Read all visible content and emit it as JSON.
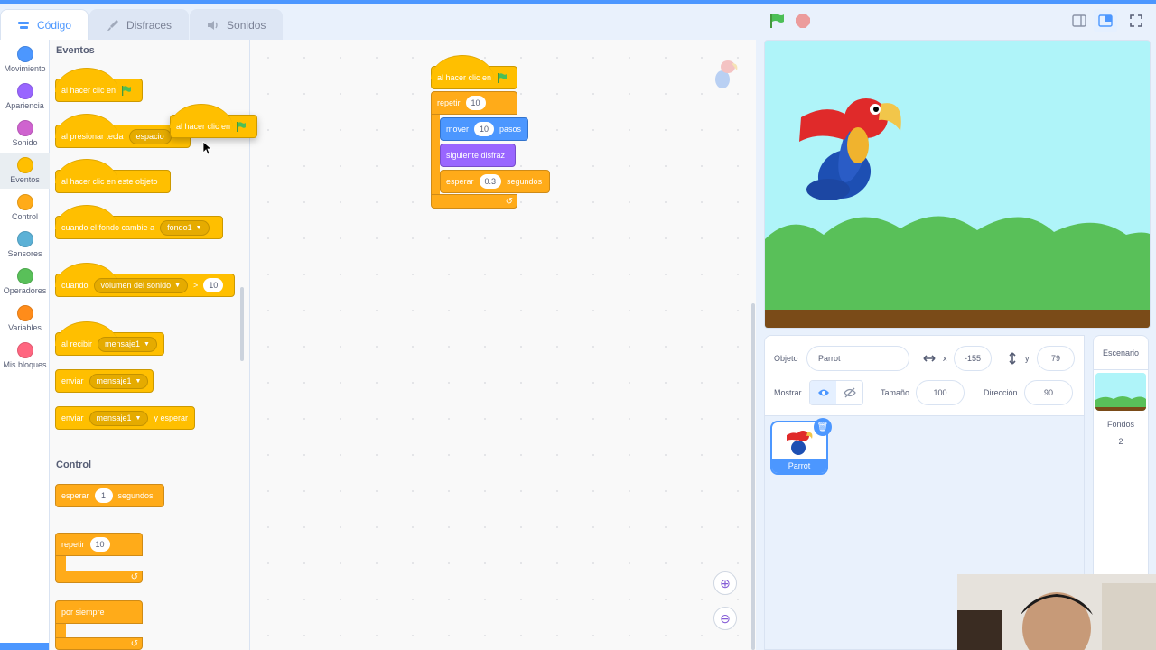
{
  "tabs": [
    {
      "label": "Código"
    },
    {
      "label": "Disfraces"
    },
    {
      "label": "Sonidos"
    }
  ],
  "categories": [
    {
      "label": "Movimiento",
      "color": "#4c97ff"
    },
    {
      "label": "Apariencia",
      "color": "#9966ff"
    },
    {
      "label": "Sonido",
      "color": "#cf63cf"
    },
    {
      "label": "Eventos",
      "color": "#ffbf00"
    },
    {
      "label": "Control",
      "color": "#ffab19"
    },
    {
      "label": "Sensores",
      "color": "#5cb1d6"
    },
    {
      "label": "Operadores",
      "color": "#59c059"
    },
    {
      "label": "Variables",
      "color": "#ff8c1a"
    },
    {
      "label": "Mis bloques",
      "color": "#ff6680"
    }
  ],
  "palette": {
    "events_title": "Eventos",
    "control_title": "Control",
    "flag_click": "al hacer clic en",
    "key_press": "al presionar tecla",
    "key_value": "espacio",
    "sprite_click": "al hacer clic en este objeto",
    "backdrop_switch": "cuando el fondo cambie a",
    "backdrop_value": "fondo1",
    "when": "cuando",
    "loudness": "volumen del sonido",
    "gt": ">",
    "loudness_value": "10",
    "receive": "al recibir",
    "message": "mensaje1",
    "broadcast": "enviar",
    "and_wait": "y esperar",
    "wait": "esperar",
    "wait_value": "1",
    "seconds": "segundos",
    "repeat": "repetir",
    "repeat_value": "10",
    "forever": "por siempre"
  },
  "dragging": {
    "label": "al hacer clic en"
  },
  "script": {
    "hat": "al hacer clic en",
    "repeat": "repetir",
    "repeat_value": "10",
    "move": "mover",
    "move_value": "10",
    "steps": "pasos",
    "next_costume": "siguiente disfraz",
    "wait": "esperar",
    "wait_value": "0.3",
    "seconds": "segundos"
  },
  "sprite_info": {
    "object_label": "Objeto",
    "object_name": "Parrot",
    "x_label": "x",
    "x_value": "-155",
    "y_label": "y",
    "y_value": "79",
    "show_label": "Mostrar",
    "size_label": "Tamaño",
    "size_value": "100",
    "direction_label": "Dirección",
    "direction_value": "90"
  },
  "sprites": [
    {
      "name": "Parrot"
    }
  ],
  "stage_panel": {
    "title": "Escenario",
    "backdrops_label": "Fondos",
    "backdrops_count": "2"
  },
  "colors": {
    "accent": "#4c97ff",
    "events": "#ffbf00",
    "control": "#ffab19",
    "motion": "#4c97ff",
    "looks": "#9966ff"
  }
}
